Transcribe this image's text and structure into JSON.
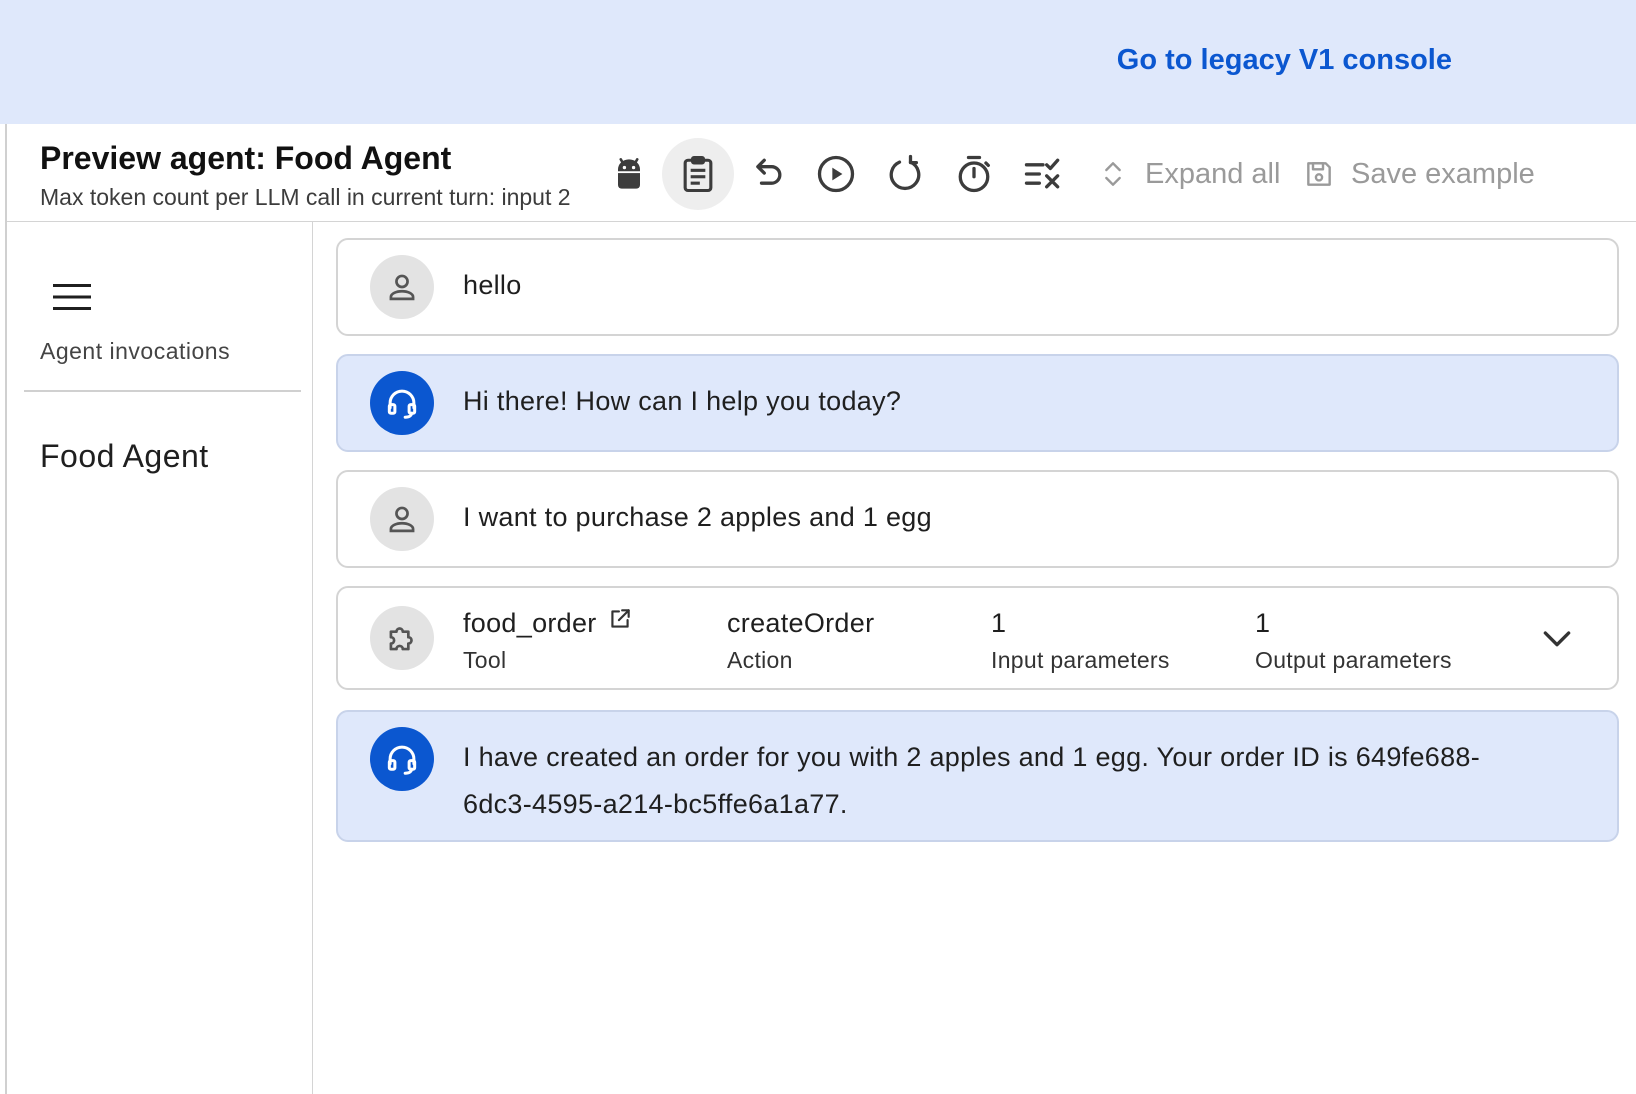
{
  "banner": {
    "legacy_link": "Go to legacy V1 console"
  },
  "header": {
    "title": "Preview agent: Food Agent",
    "subtitle": "Max token count per LLM call in current turn: input 2",
    "expand_all": "Expand all",
    "save_example": "Save example"
  },
  "sidebar": {
    "label": "Agent invocations",
    "items": [
      {
        "label": "Food Agent"
      }
    ]
  },
  "messages": [
    {
      "role": "user",
      "text": "hello"
    },
    {
      "role": "agent",
      "text": "Hi there! How can I help you today?"
    },
    {
      "role": "user",
      "text": "I want to purchase 2 apples and 1 egg"
    },
    {
      "role": "tool",
      "tool_name": "food_order",
      "tool_label": "Tool",
      "action": "createOrder",
      "action_label": "Action",
      "input_count": "1",
      "input_label": "Input parameters",
      "output_count": "1",
      "output_label": "Output parameters"
    },
    {
      "role": "agent",
      "text_line1": "I have created an order for you with 2 apples and 1 egg. Your order ID is 649fe688-",
      "text_line2": "6dc3-4595-a214-bc5ffe6a1a77."
    }
  ],
  "colors": {
    "accent": "#0b57d0",
    "banner_bg": "#dfe8fb",
    "agent_bubble": "#dfe8fb"
  },
  "icons": [
    "android-icon",
    "clipboard-icon",
    "undo-icon",
    "play-icon",
    "reset-icon",
    "timer-icon",
    "clear-list-icon",
    "expand-icon",
    "save-icon",
    "menu-icon",
    "person-icon",
    "headset-icon",
    "puzzle-icon",
    "open-in-new-icon",
    "chevron-down-icon"
  ]
}
